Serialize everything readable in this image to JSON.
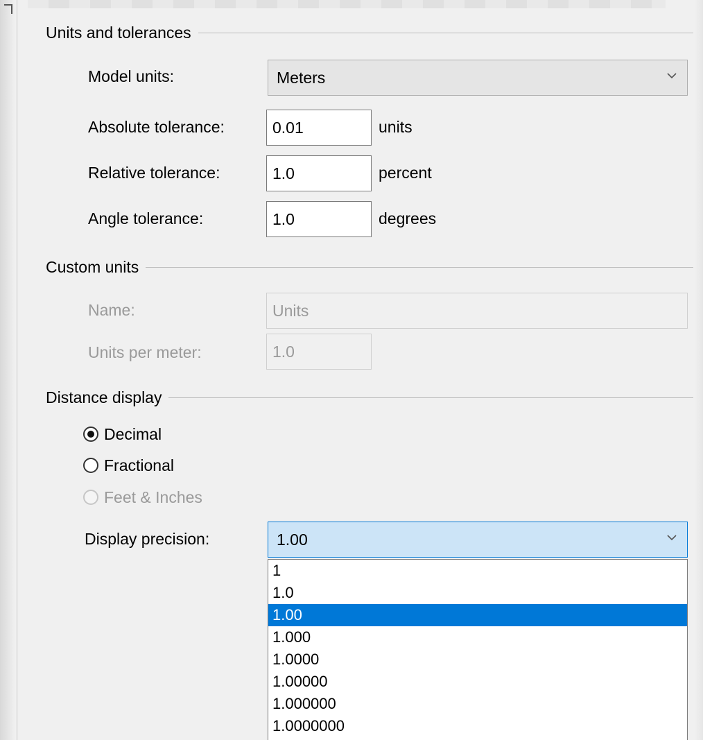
{
  "units_group": {
    "title": "Units and tolerances",
    "model_units_label": "Model units:",
    "model_units_value": "Meters",
    "absolute_tolerance_label": "Absolute tolerance:",
    "absolute_tolerance_value": "0.01",
    "absolute_tolerance_unit": "units",
    "relative_tolerance_label": "Relative tolerance:",
    "relative_tolerance_value": "1.0",
    "relative_tolerance_unit": "percent",
    "angle_tolerance_label": "Angle tolerance:",
    "angle_tolerance_value": "1.0",
    "angle_tolerance_unit": "degrees"
  },
  "custom_units_group": {
    "title": "Custom units",
    "name_label": "Name:",
    "name_value": "Units",
    "units_per_meter_label": "Units per meter:",
    "units_per_meter_value": "1.0"
  },
  "distance_display_group": {
    "title": "Distance display",
    "radios": [
      {
        "label": "Decimal",
        "checked": true,
        "enabled": true
      },
      {
        "label": "Fractional",
        "checked": false,
        "enabled": true
      },
      {
        "label": "Feet & Inches",
        "checked": false,
        "enabled": false
      }
    ],
    "display_precision_label": "Display precision:",
    "display_precision_value": "1.00",
    "precision_options": [
      "1",
      "1.0",
      "1.00",
      "1.000",
      "1.0000",
      "1.00000",
      "1.000000",
      "1.0000000"
    ],
    "selected_option": "1.00"
  },
  "icons": {
    "dropdown_arrow": "chevron-down-icon"
  },
  "colors": {
    "selection": "#0078d7",
    "active_combo_bg": "#cce4f7",
    "disabled_text": "#9a9a9a"
  }
}
